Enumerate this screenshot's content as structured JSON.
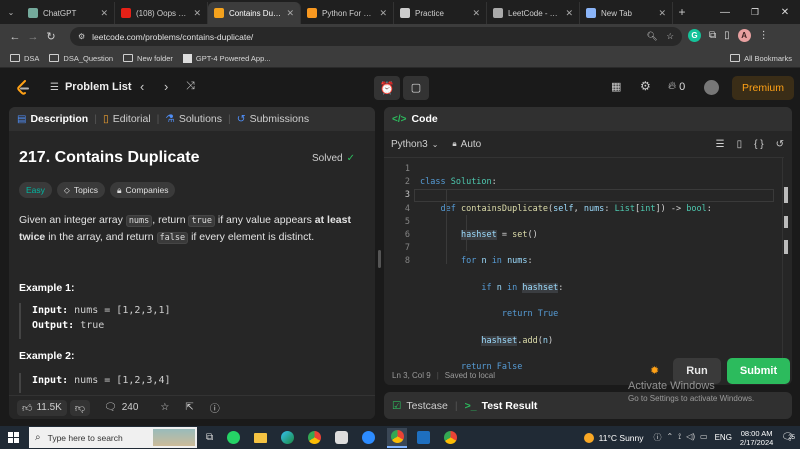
{
  "browser": {
    "tabs": [
      {
        "title": "ChatGPT",
        "color": "#74aa9c",
        "active": false
      },
      {
        "title": "(108) Oops Clas",
        "color": "#e62117",
        "active": false
      },
      {
        "title": "Contains Duplica",
        "color": "#f4a21d",
        "active": true
      },
      {
        "title": "Python For Begi",
        "color": "#f89820",
        "active": false
      },
      {
        "title": "Practice",
        "color": "#cccccc",
        "active": false
      },
      {
        "title": "LeetCode - The",
        "color": "#aaaaaa",
        "active": false
      },
      {
        "title": "New Tab",
        "color": "#8ab4f8",
        "active": false
      }
    ],
    "url": "leetcode.com/problems/contains-duplicate/",
    "bookmarks": [
      "DSA",
      "DSA_Question",
      "New folder",
      "GPT-4 Powered App..."
    ],
    "all_bookmarks": "All Bookmarks",
    "profile_initial": "A"
  },
  "header": {
    "problem_list": "Problem List",
    "coins": "0",
    "premium": "Premium"
  },
  "left": {
    "tabs": [
      "Description",
      "Editorial",
      "Solutions",
      "Submissions"
    ],
    "title": "217. Contains Duplicate",
    "status": "Solved",
    "difficulty": "Easy",
    "topics": "Topics",
    "companies": "Companies",
    "desc": {
      "p1": "Given an integer array",
      "c1": "nums",
      "p2": ", return",
      "c2": "true",
      "p3": "if any value appears",
      "b1": "at least twice",
      "p4": "in the array, and return",
      "c3": "false",
      "p5": "if every element is distinct."
    },
    "example1": {
      "label": "Example 1:",
      "input_key": "Input:",
      "input_val": "nums = [1,2,3,1]",
      "output_key": "Output:",
      "output_val": "true"
    },
    "example2": {
      "label": "Example 2:",
      "input_key": "Input:",
      "input_val": "nums = [1,2,3,4]"
    },
    "likes": "11.5K",
    "comments": "240"
  },
  "right": {
    "title": "Code",
    "language": "Python3",
    "auto": "Auto",
    "line_numbers": [
      "1",
      "2",
      "3",
      "4",
      "5",
      "6",
      "7",
      "8"
    ],
    "status_pos": "Ln 3, Col 9",
    "status_saved": "Saved to local",
    "run": "Run",
    "submit": "Submit",
    "bottom_tabs": [
      "Testcase",
      "Test Result"
    ]
  },
  "watermark": {
    "title": "Activate Windows",
    "sub": "Go to Settings to activate Windows."
  },
  "taskbar": {
    "search_placeholder": "Type here to search",
    "weather": "11°C  Sunny",
    "lang": "ENG",
    "time": "08:00 AM",
    "date": "2/17/2024",
    "notif_count": "25"
  },
  "colors": {
    "accent_green": "#2cbb5d",
    "easy_teal": "#00b8a3",
    "premium": "#ffa116"
  }
}
